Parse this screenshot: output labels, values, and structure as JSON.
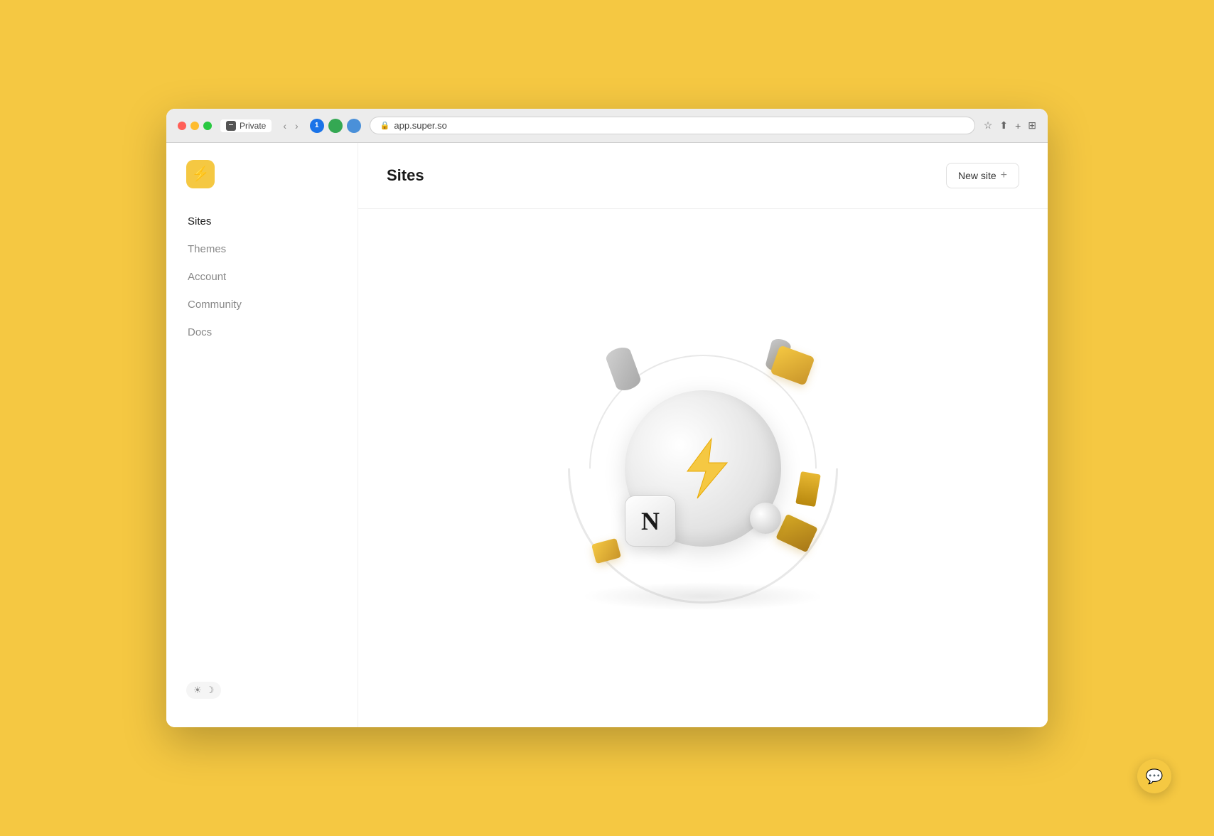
{
  "browser": {
    "url": "app.super.so",
    "tab_label": "Private"
  },
  "logo": {
    "icon": "⚡"
  },
  "nav": {
    "items": [
      {
        "label": "Sites",
        "active": true
      },
      {
        "label": "Themes",
        "active": false
      },
      {
        "label": "Account",
        "active": false
      },
      {
        "label": "Community",
        "active": false
      },
      {
        "label": "Docs",
        "active": false
      }
    ]
  },
  "header": {
    "title": "Sites",
    "new_site_label": "New site",
    "new_site_icon": "+"
  },
  "theme_toggle": {
    "sun": "☀",
    "moon": "☽"
  },
  "chat": {
    "icon": "💬"
  }
}
